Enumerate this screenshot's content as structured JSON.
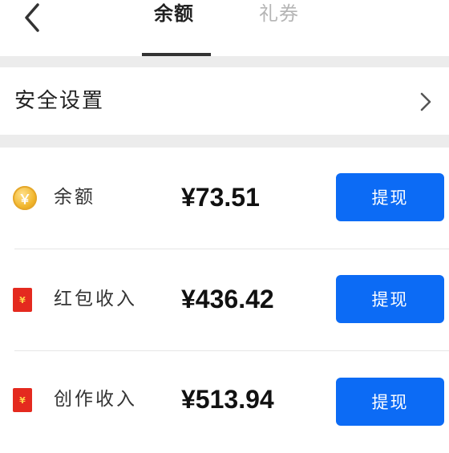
{
  "header": {
    "back_icon": "chevron-left-icon",
    "tabs": [
      {
        "label": "余额",
        "active": true
      },
      {
        "label": "礼券",
        "active": false
      }
    ]
  },
  "security": {
    "label": "安全设置",
    "icon": "chevron-right-icon"
  },
  "accounts": [
    {
      "icon": "coin-icon",
      "icon_glyph": "￥",
      "label": "余额",
      "amount": "¥73.51",
      "button_label": "提现"
    },
    {
      "icon": "red-envelope-icon",
      "icon_glyph": "¥",
      "label": "红包收入",
      "amount": "¥436.42",
      "button_label": "提现"
    },
    {
      "icon": "red-envelope-icon",
      "icon_glyph": "¥",
      "label": "创作收入",
      "amount": "¥513.94",
      "button_label": "提现"
    }
  ],
  "colors": {
    "accent": "#0c6bf5",
    "separator": "#ececec",
    "envelope": "#e42a1f",
    "coin": "#f0b429"
  }
}
